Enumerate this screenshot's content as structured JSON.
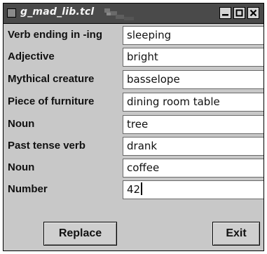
{
  "window": {
    "title": "g_mad_lib.tcl"
  },
  "fields": [
    {
      "label": "Verb ending in -ing",
      "value": "sleeping"
    },
    {
      "label": "Adjective",
      "value": "bright"
    },
    {
      "label": "Mythical creature",
      "value": "basselope"
    },
    {
      "label": "Piece of furniture",
      "value": "dining room table"
    },
    {
      "label": "Noun",
      "value": "tree"
    },
    {
      "label": "Past tense verb",
      "value": "drank"
    },
    {
      "label": "Noun",
      "value": "coffee"
    },
    {
      "label": "Number",
      "value": "42"
    }
  ],
  "buttons": {
    "replace": "Replace",
    "exit": "Exit"
  }
}
